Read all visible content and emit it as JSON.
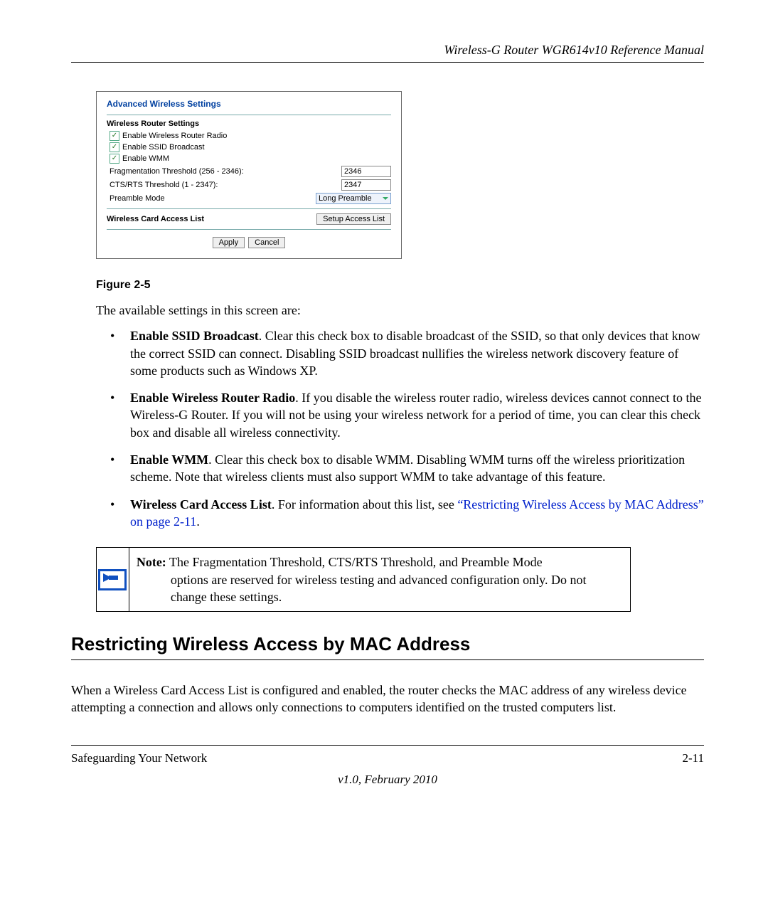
{
  "header": {
    "title": "Wireless-G Router WGR614v10 Reference Manual"
  },
  "panel": {
    "title": "Advanced Wireless Settings",
    "section1_title": "Wireless Router Settings",
    "checkboxes": [
      {
        "label": "Enable Wireless Router Radio",
        "checked": true
      },
      {
        "label": "Enable SSID Broadcast",
        "checked": true
      },
      {
        "label": "Enable WMM",
        "checked": true
      }
    ],
    "fields": [
      {
        "label": "Fragmentation Threshold (256 - 2346):",
        "value": "2346",
        "type": "text"
      },
      {
        "label": "CTS/RTS Threshold (1 - 2347):",
        "value": "2347",
        "type": "text"
      },
      {
        "label": "Preamble Mode",
        "value": "Long Preamble",
        "type": "select"
      }
    ],
    "acl_title": "Wireless Card Access List",
    "acl_button": "Setup Access List",
    "buttons": {
      "apply": "Apply",
      "cancel": "Cancel"
    }
  },
  "figure_caption": "Figure 2-5",
  "intro_text": "The available settings in this screen are:",
  "bullets": [
    {
      "bold": "Enable SSID Broadcast",
      "rest": ". Clear this check box to disable broadcast of the SSID, so that only devices that know the correct SSID can connect. Disabling SSID broadcast nullifies the wireless network discovery feature of some products such as Windows XP."
    },
    {
      "bold": "Enable Wireless Router Radio",
      "rest": ". If you disable the wireless router radio, wireless devices cannot connect to the Wireless-G Router. If you will not be using your wireless network for a period of time, you can clear this check box and disable all wireless connectivity."
    },
    {
      "bold": "Enable WMM",
      "rest": ". Clear this check box to disable WMM. Disabling WMM turns off the wireless prioritization scheme. Note that wireless clients must also support WMM to take advantage of this feature."
    },
    {
      "bold": "Wireless Card Access List",
      "rest_before_link": ". For information about this list, see ",
      "link_text": "“Restricting Wireless Access by MAC Address” on page 2-11",
      "rest_after_link": "."
    }
  ],
  "note": {
    "label": "Note:",
    "line1": " The Fragmentation Threshold, CTS/RTS Threshold, and Preamble Mode",
    "line2": "options are reserved for wireless testing and advanced configuration only. Do not change these settings."
  },
  "section_heading": "Restricting Wireless Access by MAC Address",
  "section_para": "When a Wireless Card Access List is configured and enabled, the router checks the MAC address of any wireless device attempting a connection and allows only connections to computers identified on the trusted computers list.",
  "footer": {
    "left": "Safeguarding Your Network",
    "right": "2-11",
    "version": "v1.0, February 2010"
  }
}
